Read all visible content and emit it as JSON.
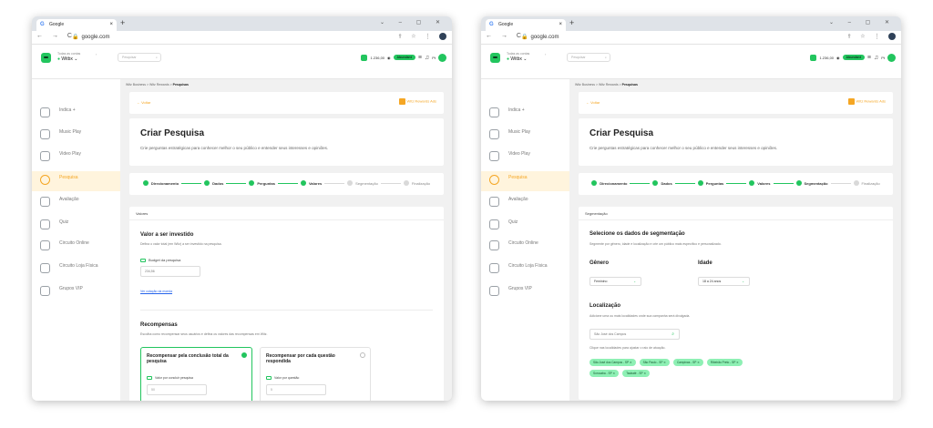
{
  "browser": {
    "tab_title": "Google",
    "tab_close": "×",
    "new_tab": "+",
    "window_controls": "⌄ – ▢ ✕",
    "nav": "← → C",
    "url": "google.com",
    "right_icons": "⇪ ☆ ⋮"
  },
  "app": {
    "org_label": "Todas as contas",
    "org_name": "Witbx",
    "search_placeholder": "Pesquisar",
    "balance": "1.236,00",
    "status_pill": "Abundant",
    "user_short": "Pt",
    "collapse": "‹"
  },
  "sidebar": {
    "items": [
      {
        "label": "Indica +"
      },
      {
        "label": "Music Play"
      },
      {
        "label": "Video Play"
      },
      {
        "label": "Pesquisa"
      },
      {
        "label": "Avaliação"
      },
      {
        "label": "Quiz"
      },
      {
        "label": "Circuito Online"
      },
      {
        "label": "Circuito Loja Física"
      },
      {
        "label": "Grupos VIP"
      }
    ]
  },
  "breadcrumb": {
    "a": "Witz Business",
    "b": "Witz Rewards",
    "c": "Pesquisas",
    "sep": ">"
  },
  "header_card": {
    "back": "← Voltar",
    "ads": "Witz Rewards Ads"
  },
  "title_card": {
    "title": "Criar Pesquisa",
    "subtitle": "Crie perguntas estratégicas para conhecer melhor o seu público e entender seus interesses e opiniões."
  },
  "steps": [
    {
      "label": "Direcionamento"
    },
    {
      "label": "Dados"
    },
    {
      "label": "Perguntas"
    },
    {
      "label": "Valores"
    },
    {
      "label": "Segmentação"
    },
    {
      "label": "Finalização"
    }
  ],
  "left": {
    "section": "Valores",
    "invest_title": "Valor a ser investido",
    "invest_desc": "Defina o valor total (em Witz) a ser investido na pesquisa.",
    "budget_label": "Budget da pesquisa",
    "budget_value": "234,56",
    "quote_link": "Ver cotação da moeda",
    "rewards_title": "Recompensas",
    "rewards_desc": "Escolha como recompensar seus usuários e defina os valores das recompensas em Witz.",
    "card1_title": "Recompensar pela conclusão total da pesquisa",
    "card1_label": "Valor por concluir pesquisa",
    "card1_value": "50",
    "card2_title": "Recompensar por cada questão respondida",
    "card2_label": "Valor por questão",
    "card2_value": "5"
  },
  "right": {
    "section": "Segmentação",
    "seg_title": "Selecione os dados de segmentação",
    "seg_desc": "Segmente por gênero, idade e localização e crie um público mais específico e personalizado.",
    "gender_title": "Gênero",
    "gender_value": "Feminino",
    "age_title": "Idade",
    "age_value": "18 a 24 anos",
    "loc_title": "Localização",
    "loc_desc": "Adicione uma ou mais localidades onde sua campanha será divulgada.",
    "loc_input": "São José dos Campos",
    "loc_help": "Clique nas localidades para ajustar o raio de atuação.",
    "chips": [
      "São José dos Campos - SP ✕",
      "São Paulo - SP ✕",
      "Campinas - SP ✕",
      "Ribeirão Preto - SP ✕",
      "Sorocaba - SP ✕",
      "Taubaté - SP ✕"
    ]
  }
}
